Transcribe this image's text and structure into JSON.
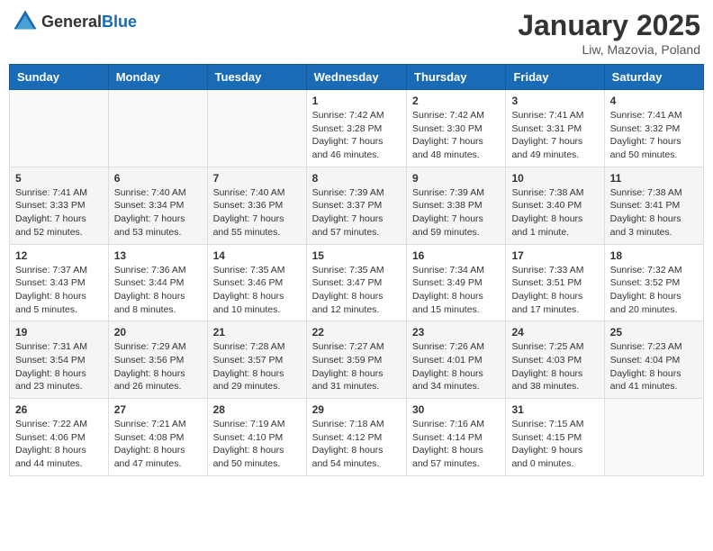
{
  "header": {
    "logo_general": "General",
    "logo_blue": "Blue",
    "month_title": "January 2025",
    "location": "Liw, Mazovia, Poland"
  },
  "weekdays": [
    "Sunday",
    "Monday",
    "Tuesday",
    "Wednesday",
    "Thursday",
    "Friday",
    "Saturday"
  ],
  "weeks": [
    [
      {
        "day": "",
        "content": ""
      },
      {
        "day": "",
        "content": ""
      },
      {
        "day": "",
        "content": ""
      },
      {
        "day": "1",
        "content": "Sunrise: 7:42 AM\nSunset: 3:28 PM\nDaylight: 7 hours and 46 minutes."
      },
      {
        "day": "2",
        "content": "Sunrise: 7:42 AM\nSunset: 3:30 PM\nDaylight: 7 hours and 48 minutes."
      },
      {
        "day": "3",
        "content": "Sunrise: 7:41 AM\nSunset: 3:31 PM\nDaylight: 7 hours and 49 minutes."
      },
      {
        "day": "4",
        "content": "Sunrise: 7:41 AM\nSunset: 3:32 PM\nDaylight: 7 hours and 50 minutes."
      }
    ],
    [
      {
        "day": "5",
        "content": "Sunrise: 7:41 AM\nSunset: 3:33 PM\nDaylight: 7 hours and 52 minutes."
      },
      {
        "day": "6",
        "content": "Sunrise: 7:40 AM\nSunset: 3:34 PM\nDaylight: 7 hours and 53 minutes."
      },
      {
        "day": "7",
        "content": "Sunrise: 7:40 AM\nSunset: 3:36 PM\nDaylight: 7 hours and 55 minutes."
      },
      {
        "day": "8",
        "content": "Sunrise: 7:39 AM\nSunset: 3:37 PM\nDaylight: 7 hours and 57 minutes."
      },
      {
        "day": "9",
        "content": "Sunrise: 7:39 AM\nSunset: 3:38 PM\nDaylight: 7 hours and 59 minutes."
      },
      {
        "day": "10",
        "content": "Sunrise: 7:38 AM\nSunset: 3:40 PM\nDaylight: 8 hours and 1 minute."
      },
      {
        "day": "11",
        "content": "Sunrise: 7:38 AM\nSunset: 3:41 PM\nDaylight: 8 hours and 3 minutes."
      }
    ],
    [
      {
        "day": "12",
        "content": "Sunrise: 7:37 AM\nSunset: 3:43 PM\nDaylight: 8 hours and 5 minutes."
      },
      {
        "day": "13",
        "content": "Sunrise: 7:36 AM\nSunset: 3:44 PM\nDaylight: 8 hours and 8 minutes."
      },
      {
        "day": "14",
        "content": "Sunrise: 7:35 AM\nSunset: 3:46 PM\nDaylight: 8 hours and 10 minutes."
      },
      {
        "day": "15",
        "content": "Sunrise: 7:35 AM\nSunset: 3:47 PM\nDaylight: 8 hours and 12 minutes."
      },
      {
        "day": "16",
        "content": "Sunrise: 7:34 AM\nSunset: 3:49 PM\nDaylight: 8 hours and 15 minutes."
      },
      {
        "day": "17",
        "content": "Sunrise: 7:33 AM\nSunset: 3:51 PM\nDaylight: 8 hours and 17 minutes."
      },
      {
        "day": "18",
        "content": "Sunrise: 7:32 AM\nSunset: 3:52 PM\nDaylight: 8 hours and 20 minutes."
      }
    ],
    [
      {
        "day": "19",
        "content": "Sunrise: 7:31 AM\nSunset: 3:54 PM\nDaylight: 8 hours and 23 minutes."
      },
      {
        "day": "20",
        "content": "Sunrise: 7:29 AM\nSunset: 3:56 PM\nDaylight: 8 hours and 26 minutes."
      },
      {
        "day": "21",
        "content": "Sunrise: 7:28 AM\nSunset: 3:57 PM\nDaylight: 8 hours and 29 minutes."
      },
      {
        "day": "22",
        "content": "Sunrise: 7:27 AM\nSunset: 3:59 PM\nDaylight: 8 hours and 31 minutes."
      },
      {
        "day": "23",
        "content": "Sunrise: 7:26 AM\nSunset: 4:01 PM\nDaylight: 8 hours and 34 minutes."
      },
      {
        "day": "24",
        "content": "Sunrise: 7:25 AM\nSunset: 4:03 PM\nDaylight: 8 hours and 38 minutes."
      },
      {
        "day": "25",
        "content": "Sunrise: 7:23 AM\nSunset: 4:04 PM\nDaylight: 8 hours and 41 minutes."
      }
    ],
    [
      {
        "day": "26",
        "content": "Sunrise: 7:22 AM\nSunset: 4:06 PM\nDaylight: 8 hours and 44 minutes."
      },
      {
        "day": "27",
        "content": "Sunrise: 7:21 AM\nSunset: 4:08 PM\nDaylight: 8 hours and 47 minutes."
      },
      {
        "day": "28",
        "content": "Sunrise: 7:19 AM\nSunset: 4:10 PM\nDaylight: 8 hours and 50 minutes."
      },
      {
        "day": "29",
        "content": "Sunrise: 7:18 AM\nSunset: 4:12 PM\nDaylight: 8 hours and 54 minutes."
      },
      {
        "day": "30",
        "content": "Sunrise: 7:16 AM\nSunset: 4:14 PM\nDaylight: 8 hours and 57 minutes."
      },
      {
        "day": "31",
        "content": "Sunrise: 7:15 AM\nSunset: 4:15 PM\nDaylight: 9 hours and 0 minutes."
      },
      {
        "day": "",
        "content": ""
      }
    ]
  ]
}
